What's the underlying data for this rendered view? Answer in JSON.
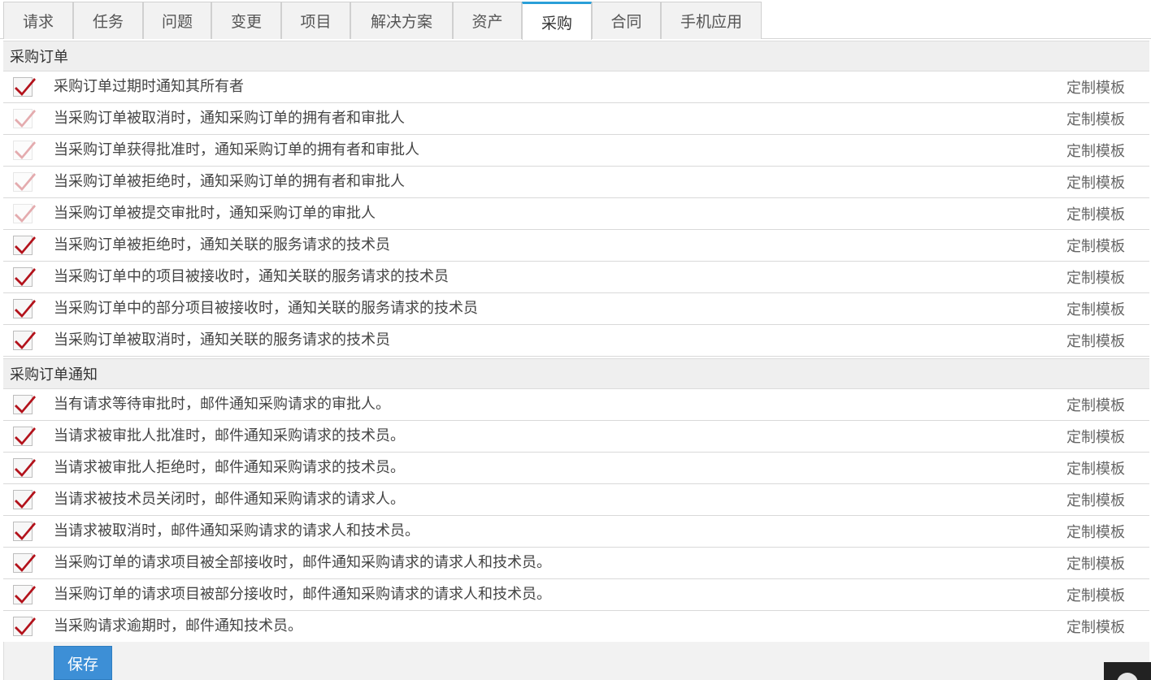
{
  "tabs": [
    {
      "label": "请求"
    },
    {
      "label": "任务"
    },
    {
      "label": "问题"
    },
    {
      "label": "变更"
    },
    {
      "label": "项目"
    },
    {
      "label": "解决方案"
    },
    {
      "label": "资产"
    },
    {
      "label": "采购",
      "active": true
    },
    {
      "label": "合同"
    },
    {
      "label": "手机应用"
    }
  ],
  "sections": [
    {
      "title": "采购订单",
      "rows": [
        {
          "label": "采购订单过期时通知其所有者",
          "checked": true,
          "enabled": true,
          "link": "定制模板"
        },
        {
          "label": "当采购订单被取消时，通知采购订单的拥有者和审批人",
          "checked": true,
          "enabled": false,
          "link": "定制模板"
        },
        {
          "label": "当采购订单获得批准时，通知采购订单的拥有者和审批人",
          "checked": true,
          "enabled": false,
          "link": "定制模板"
        },
        {
          "label": "当采购订单被拒绝时，通知采购订单的拥有者和审批人",
          "checked": true,
          "enabled": false,
          "link": "定制模板"
        },
        {
          "label": "当采购订单被提交审批时，通知采购订单的审批人",
          "checked": true,
          "enabled": false,
          "link": "定制模板"
        },
        {
          "label": "当采购订单被拒绝时，通知关联的服务请求的技术员",
          "checked": true,
          "enabled": true,
          "link": "定制模板"
        },
        {
          "label": "当采购订单中的项目被接收时，通知关联的服务请求的技术员",
          "checked": true,
          "enabled": true,
          "link": "定制模板"
        },
        {
          "label": "当采购订单中的部分项目被接收时，通知关联的服务请求的技术员",
          "checked": true,
          "enabled": true,
          "link": "定制模板"
        },
        {
          "label": "当采购订单被取消时，通知关联的服务请求的技术员",
          "checked": true,
          "enabled": true,
          "link": "定制模板"
        }
      ]
    },
    {
      "title": "采购订单通知",
      "rows": [
        {
          "label": "当有请求等待审批时，邮件通知采购请求的审批人。",
          "checked": true,
          "enabled": true,
          "link": "定制模板"
        },
        {
          "label": "当请求被审批人批准时，邮件通知采购请求的技术员。",
          "checked": true,
          "enabled": true,
          "link": "定制模板"
        },
        {
          "label": "当请求被审批人拒绝时，邮件通知采购请求的技术员。",
          "checked": true,
          "enabled": true,
          "link": "定制模板"
        },
        {
          "label": "当请求被技术员关闭时，邮件通知采购请求的请求人。",
          "checked": true,
          "enabled": true,
          "link": "定制模板"
        },
        {
          "label": "当请求被取消时，邮件通知采购请求的请求人和技术员。",
          "checked": true,
          "enabled": true,
          "link": "定制模板"
        },
        {
          "label": "当采购订单的请求项目被全部接收时，邮件通知采购请求的请求人和技术员。",
          "checked": true,
          "enabled": true,
          "link": "定制模板"
        },
        {
          "label": "当采购订单的请求项目被部分接收时，邮件通知采购请求的请求人和技术员。",
          "checked": true,
          "enabled": true,
          "link": "定制模板"
        },
        {
          "label": "当采购请求逾期时，邮件通知技术员。",
          "checked": true,
          "enabled": true,
          "link": "定制模板"
        }
      ]
    }
  ],
  "footer": {
    "save_label": "保存"
  },
  "colors": {
    "accent": "#2a9fd8",
    "save_button": "#3d8fd6",
    "check": "#b3121b"
  },
  "icons": {
    "checkbox": "checkmark-icon"
  }
}
